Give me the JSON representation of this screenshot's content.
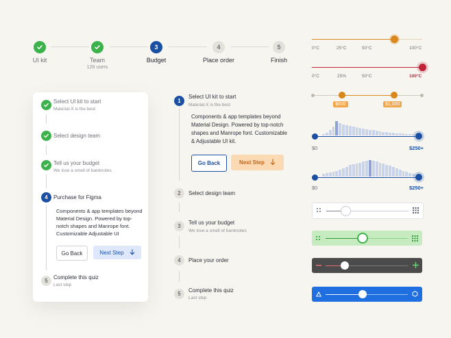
{
  "top_stepper": {
    "steps": [
      {
        "label": "UI kit",
        "sub": "",
        "state": "done",
        "num": ""
      },
      {
        "label": "Team",
        "sub": "128 users",
        "state": "done",
        "num": ""
      },
      {
        "label": "Budget",
        "sub": "",
        "state": "active",
        "num": "3"
      },
      {
        "label": "Place order",
        "sub": "",
        "state": "todo",
        "num": "4"
      },
      {
        "label": "Finish",
        "sub": "",
        "state": "todo",
        "num": "5"
      }
    ]
  },
  "card_stepper": {
    "steps": [
      {
        "title": "Select UI kit to start",
        "sub": "Material-X is the best",
        "state": "done"
      },
      {
        "title": "Select design team",
        "sub": "",
        "state": "done"
      },
      {
        "title": "Tell us your budget",
        "sub": "We love a smell of banknotes",
        "state": "done"
      },
      {
        "title": "Purchase for Figma",
        "sub": "",
        "state": "active",
        "num": "4"
      },
      {
        "title": "Complete this quiz",
        "sub": "Last step",
        "state": "todo",
        "num": "5"
      }
    ],
    "body": "Components & app templates beyond Material Design. Powered by top-notch shapes and Manrope font. Customizable Adjustable UI",
    "back_label": "Go Back",
    "next_label": "Next Step"
  },
  "middle_stepper": {
    "steps": [
      {
        "title": "Select UI kit to start",
        "sub": "Material-X is the best",
        "num": "1",
        "state": "active"
      },
      {
        "title": "Select design team",
        "sub": "",
        "num": "2",
        "state": "todo"
      },
      {
        "title": "Tell us your budget",
        "sub": "We love a smell of banknotes",
        "num": "3",
        "state": "todo"
      },
      {
        "title": "Place your order",
        "sub": "",
        "num": "4",
        "state": "todo"
      },
      {
        "title": "Complete this quiz",
        "sub": "Last step",
        "num": "5",
        "state": "todo"
      }
    ],
    "body": "Components & app templates beyond Material Design. Powered by top-notch shapes and Manrope font. Customizable & Adjustable UI kit.",
    "back_label": "Go Back",
    "next_label": "Next Step"
  },
  "sliders": {
    "temp1": {
      "ticks": [
        "0°C",
        "25°C",
        "50°C",
        "100°C"
      ],
      "value": 0.75,
      "color": "#d9861a"
    },
    "temp2": {
      "ticks": [
        "0°C",
        "25%",
        "50°C",
        "100°C"
      ],
      "value": 1.0,
      "color": "#c0223a"
    },
    "price_range": {
      "low_label": "$600",
      "high_label": "$1,000",
      "low": 0.27,
      "high": 0.75,
      "color": "#d9861a"
    },
    "hist1": {
      "min_label": "$0",
      "max_label": "$250+",
      "color": "#1a4fa3",
      "bars": [
        0.1,
        0.2,
        0.35,
        0.6,
        0.95,
        0.8,
        0.75,
        0.7,
        0.65,
        0.6,
        0.55,
        0.5,
        0.45,
        0.42,
        0.38,
        0.35,
        0.3,
        0.28,
        0.25,
        0.22,
        0.2,
        0.18,
        0.15,
        0.13,
        0.12,
        0.1,
        0.1,
        0.08
      ]
    },
    "hist2": {
      "min_label": "$0",
      "max_label": "$250+",
      "color": "#1a4fa3",
      "bars": [
        0.15,
        0.2,
        0.25,
        0.3,
        0.35,
        0.4,
        0.5,
        0.6,
        0.7,
        0.75,
        0.8,
        0.85,
        0.9,
        0.95,
        1.0,
        0.95,
        0.9,
        0.85,
        0.8,
        0.72,
        0.65,
        0.58,
        0.5,
        0.42,
        0.35,
        0.28,
        0.22,
        0.15
      ]
    },
    "icon_sliders": [
      {
        "value": 0.23,
        "bg": "#ffffff",
        "track": "#9aa0aa",
        "thumb": "#ffffff"
      },
      {
        "value": 0.45,
        "bg": "#c6ebc1",
        "track": "#3cb24a",
        "thumb": "#ffffff"
      },
      {
        "value": 0.23,
        "bg": "#4b4b4b",
        "track": "#e06f6f",
        "thumb": "#ffffff"
      },
      {
        "value": 0.45,
        "bg": "#1f6fe0",
        "track": "#ffffff",
        "thumb": "#ffffff"
      }
    ]
  }
}
